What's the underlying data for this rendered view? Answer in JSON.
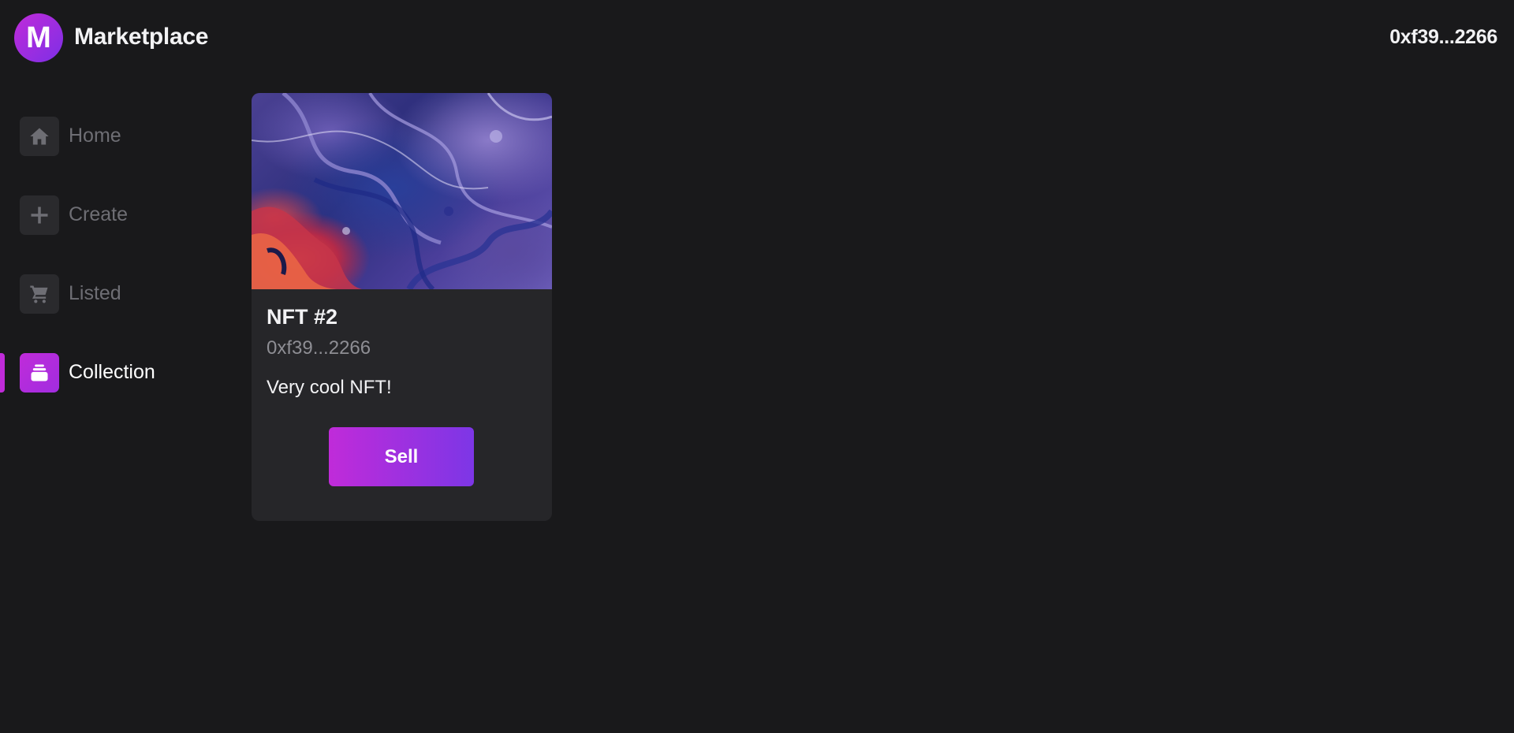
{
  "header": {
    "logo_letter": "M",
    "brand": "Marketplace",
    "wallet_address": "0xf39...2266"
  },
  "sidebar": {
    "items": [
      {
        "label": "Home",
        "icon": "home-icon",
        "active": false
      },
      {
        "label": "Create",
        "icon": "plus-icon",
        "active": false
      },
      {
        "label": "Listed",
        "icon": "cart-icon",
        "active": false
      },
      {
        "label": "Collection",
        "icon": "collection-icon",
        "active": true
      }
    ]
  },
  "card": {
    "image": "abstract-fluid-art-image",
    "title": "NFT #2",
    "owner": "0xf39...2266",
    "description": "Very cool NFT!",
    "button_label": "Sell"
  },
  "colors": {
    "background": "#19191b",
    "card": "#262629",
    "accent_start": "#c02bd9",
    "accent_end": "#7d36e6",
    "muted_text": "#6e6e74"
  }
}
